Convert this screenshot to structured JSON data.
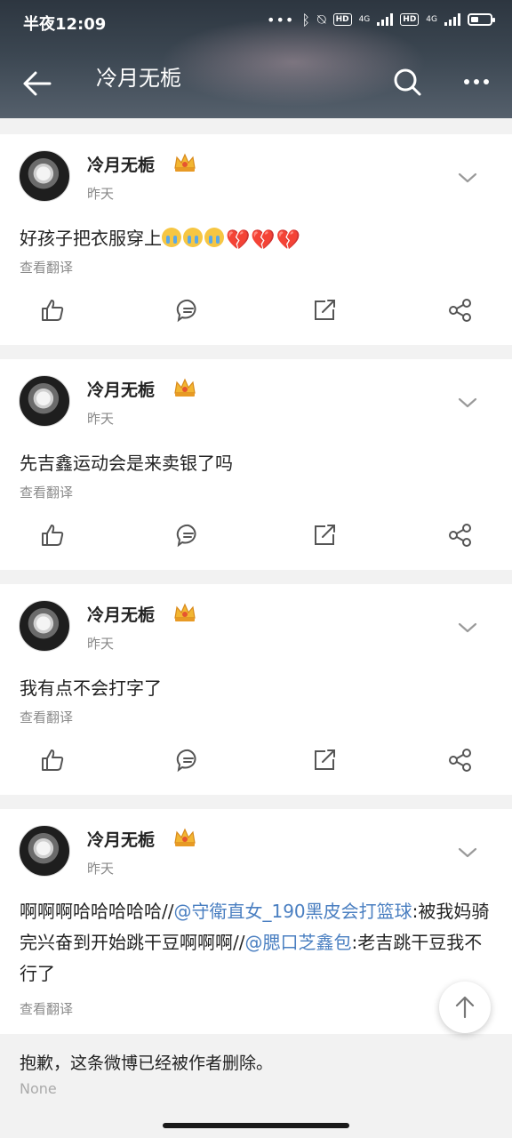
{
  "status_bar": {
    "time": "半夜12:09",
    "net1": "4G",
    "net2": "4G",
    "hd": "HD"
  },
  "nav": {
    "title": "冷月无栀"
  },
  "posts": [
    {
      "author": "冷月无栀",
      "time": "昨天",
      "text": "好孩子把衣服穿上",
      "translate": "查看翻译"
    },
    {
      "author": "冷月无栀",
      "time": "昨天",
      "text": "先吉鑫运动会是来卖银了吗",
      "translate": "查看翻译"
    },
    {
      "author": "冷月无栀",
      "time": "昨天",
      "text": "我有点不会打字了",
      "translate": "查看翻译"
    },
    {
      "author": "冷月无栀",
      "time": "昨天",
      "text_part1": "啊啊啊哈哈哈哈哈//",
      "mention1": "@守衛直女_190黑皮会打篮球",
      "text_part2": ":被我妈骑完兴奋到开始跳干豆啊啊啊//",
      "mention2": "@腮口芝鑫包",
      "text_part3": ":老吉跳干豆我不行了",
      "translate": "查看翻译"
    }
  ],
  "deleted": {
    "message": "抱歉，这条微博已经被作者删除。",
    "sub": "None"
  },
  "colors": {
    "mention": "#4a7fc1",
    "header": "#3b4651"
  }
}
